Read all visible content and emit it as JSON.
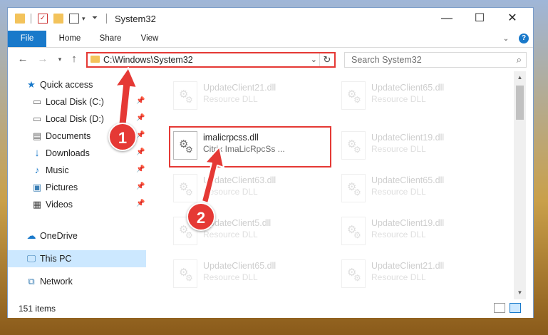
{
  "window": {
    "title": "System32",
    "minimize_glyph": "—",
    "maximize_glyph": "☐",
    "close_glyph": "✕"
  },
  "ribbon": {
    "tabs": [
      "File",
      "Home",
      "Share",
      "View"
    ],
    "help_glyph": "?"
  },
  "address": {
    "path": "C:\\Windows\\System32",
    "search_placeholder": "Search System32"
  },
  "nav_pane": {
    "items": [
      {
        "label": "Quick access",
        "icon": "star-icon"
      },
      {
        "label": "Local Disk (C:)",
        "icon": "drive-icon"
      },
      {
        "label": "Local Disk (D:)",
        "icon": "drive-icon"
      },
      {
        "label": "Documents",
        "icon": "documents-icon"
      },
      {
        "label": "Downloads",
        "icon": "download-icon"
      },
      {
        "label": "Music",
        "icon": "music-icon"
      },
      {
        "label": "Pictures",
        "icon": "pictures-icon"
      },
      {
        "label": "Videos",
        "icon": "video-icon"
      },
      {
        "label": "OneDrive",
        "icon": "cloud-icon"
      },
      {
        "label": "This PC",
        "icon": "computer-icon"
      },
      {
        "label": "Network",
        "icon": "network-icon"
      }
    ]
  },
  "files": [
    {
      "name": "UpdateClient21.dll",
      "type": "Resource DLL"
    },
    {
      "name": "UpdateClient65.dll",
      "type": "Resource DLL"
    },
    {
      "name": "imalicrpcss.dll",
      "type": "Citrix ImaLicRpcSs ..."
    },
    {
      "name": "UpdateClient19.dll",
      "type": "Resource DLL"
    },
    {
      "name": "UpdateClient63.dll",
      "type": "Resource DLL"
    },
    {
      "name": "UpdateClient65.dll",
      "type": "Resource DLL"
    },
    {
      "name": "UpdateClient5.dll",
      "type": "Resource DLL"
    },
    {
      "name": "UpdateClient19.dll",
      "type": "Resource DLL"
    },
    {
      "name": "UpdateClient65.dll",
      "type": "Resource DLL"
    },
    {
      "name": "UpdateClient21.dll",
      "type": "Resource DLL"
    }
  ],
  "status": {
    "item_count": "151 items"
  },
  "annotations": {
    "step1": "1",
    "step2": "2",
    "color": "#e53935"
  }
}
